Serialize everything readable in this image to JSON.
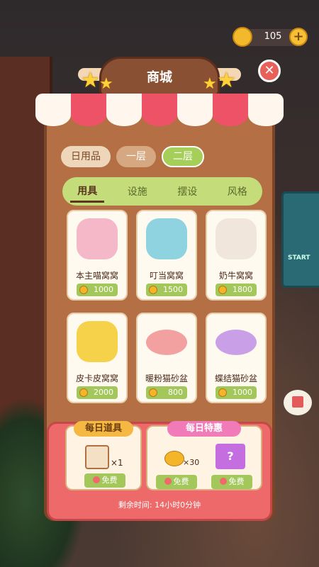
{
  "coins": {
    "amount": "105",
    "plus": "+"
  },
  "close": "✕",
  "title": "商城",
  "bg_sign": "START",
  "top_tabs": [
    {
      "label": "日用品",
      "style": "tab1"
    },
    {
      "label": "一层",
      "style": "tab1 dark"
    },
    {
      "label": "二层",
      "style": "tab1 active"
    }
  ],
  "sub_tabs": [
    {
      "label": "用具",
      "active": true
    },
    {
      "label": "设施",
      "active": false
    },
    {
      "label": "摆设",
      "active": false
    },
    {
      "label": "风格",
      "active": false
    }
  ],
  "items": [
    {
      "name": "本主喵窝窝",
      "price": "1000",
      "color": "#f4b8c9"
    },
    {
      "name": "叮当窝窝",
      "price": "1500",
      "color": "#8fd3e0"
    },
    {
      "name": "奶牛窝窝",
      "price": "1800",
      "color": "#f0e6dc"
    },
    {
      "name": "皮卡皮窝窝",
      "price": "2000",
      "color": "#f6d24a"
    },
    {
      "name": "暖粉猫砂盆",
      "price": "800",
      "color": "#f3a0a0"
    },
    {
      "name": "蝶结猫砂盆",
      "price": "1000",
      "color": "#c9a0e8"
    }
  ],
  "daily_item": {
    "title": "每日道具",
    "count": "×1",
    "button": "免费"
  },
  "daily_deal": {
    "title": "每日特惠",
    "count": "×30",
    "button1": "免费",
    "button2": "免费"
  },
  "timer": "剩余时间: 14小时0分钟"
}
